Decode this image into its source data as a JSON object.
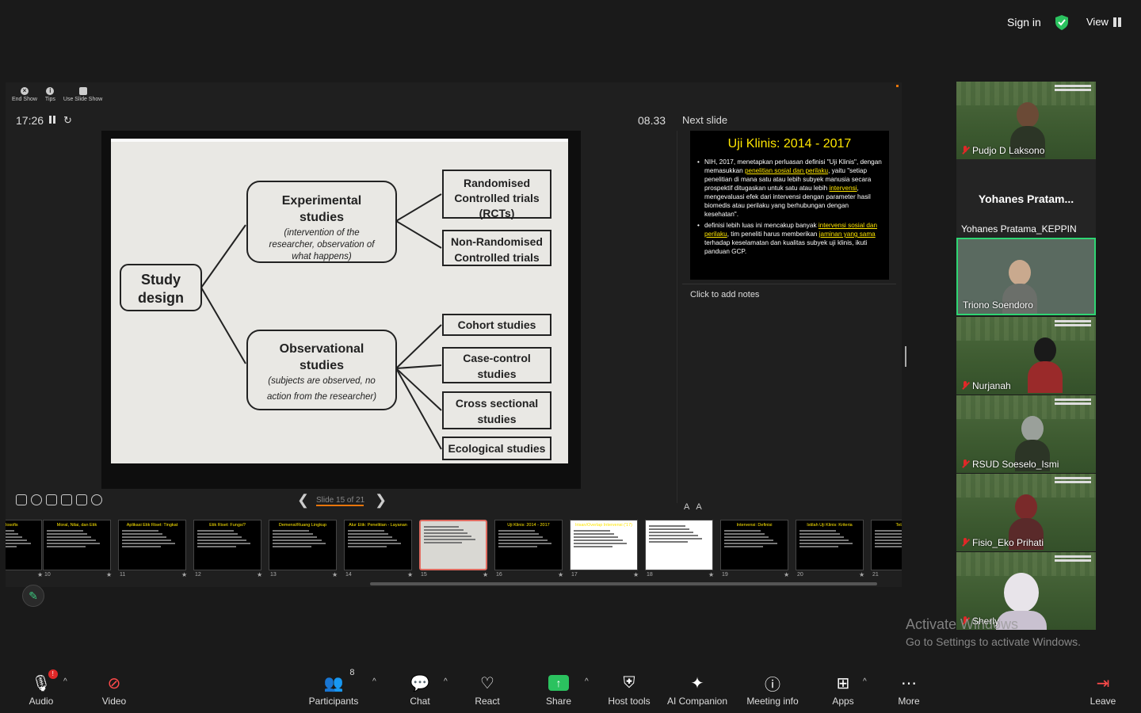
{
  "topbar": {
    "signin": "Sign in",
    "view": "View"
  },
  "presenter": {
    "tools": [
      "End Show",
      "Tips",
      "Use Slide Show"
    ],
    "timer": "17:26",
    "clock": "08.33",
    "next_label": "Next slide",
    "notes_placeholder": "Click to add notes",
    "slide_counter": "Slide 15 of 21",
    "font_bigger": "A",
    "font_smaller": "A"
  },
  "main_slide": {
    "root": [
      "Study",
      "design"
    ],
    "experimental": [
      "Experimental",
      "studies"
    ],
    "experimental_note": [
      "(intervention of the",
      "researcher, observation of",
      "what happens)"
    ],
    "observational": [
      "Observational",
      "studies"
    ],
    "observational_note": [
      "(subjects are observed, no",
      "action from the researcher)"
    ],
    "exp_children": [
      [
        "Randomised",
        "Controlled trials",
        "(RCTs)"
      ],
      [
        "Non-Randomised",
        "Controlled trials"
      ]
    ],
    "obs_children": [
      [
        "Cohort studies"
      ],
      [
        "Case-control",
        "studies"
      ],
      [
        "Cross sectional",
        "studies"
      ],
      [
        "Ecological studies"
      ]
    ]
  },
  "next_slide": {
    "title": "Uji Klinis: 2014 - 2017",
    "b1_pre": "NIH, 2017, menetapkan perluasan definisi \"Uji Klinis\", dengan memasukkan ",
    "b1_h1": "penelitian sosial dan perilaku",
    "b1_mid": ", yaitu \"setiap penelitian di mana satu atau lebih subyek manusia secara prospektif ditugaskan untuk satu atau lebih ",
    "b1_h2": "intervensi",
    "b1_post": ", mengevaluasi efek dari intervensi dengan parameter hasil biomedis atau perilaku yang berhubungan dengan kesehatan\".",
    "b2_pre": "definisi lebih luas ini mencakup banyak ",
    "b2_h1": "intervensi sosial dan perilaku",
    "b2_mid": ", tim peneliti harus memberikan ",
    "b2_h2": "jaminan yang sama",
    "b2_post": " terhadap keselamatan dan kualitas subyek uji klinis, ikuti panduan GCP."
  },
  "thumbnails": [
    {
      "num": "",
      "title": "& Filosofis"
    },
    {
      "num": "10",
      "title": "Moral, Nilai, dan Etik"
    },
    {
      "num": "11",
      "title": "Aplikasi Etik Riset: Tingkat"
    },
    {
      "num": "12",
      "title": "Etik Riset: Fungsi?"
    },
    {
      "num": "13",
      "title": "Demensi/Ruang Lingkup"
    },
    {
      "num": "14",
      "title": "Alur Etik: Penelitian - Layanan"
    },
    {
      "num": "15",
      "title": ""
    },
    {
      "num": "16",
      "title": "Uji Klinis: 2014 - 2017"
    },
    {
      "num": "17",
      "title": "Irisan/Overlap Intervensi ('17)"
    },
    {
      "num": "18",
      "title": ""
    },
    {
      "num": "19",
      "title": "Intervensi: Definisi"
    },
    {
      "num": "20",
      "title": "Istilah Uji Klinis: Kriteria"
    },
    {
      "num": "21",
      "title": "Telaah Et"
    }
  ],
  "participants": [
    {
      "name": "Pudjo D Laksono",
      "muted": true
    },
    {
      "name": "Yohanes Pratama_KEPPIN",
      "display": "Yohanes  Pratam...",
      "muted": false
    },
    {
      "name": "Triono Soendoro",
      "muted": false
    },
    {
      "name": "Nurjanah",
      "muted": true
    },
    {
      "name": "RSUD Soeselo_Ismi",
      "muted": true
    },
    {
      "name": "Fisio_Eko Prihati",
      "muted": true
    },
    {
      "name": "Sherly",
      "muted": true
    }
  ],
  "watermark": {
    "title": "Activate Windows",
    "sub": "Go to Settings to activate Windows."
  },
  "toolbar": {
    "audio": "Audio",
    "video": "Video",
    "participants": "Participants",
    "participants_count": "8",
    "chat": "Chat",
    "react": "React",
    "share": "Share",
    "host_tools": "Host tools",
    "ai": "AI Companion",
    "meeting_info": "Meeting info",
    "apps": "Apps",
    "more": "More",
    "leave": "Leave"
  },
  "colors": {
    "accent_green": "#2bc25f",
    "mute_red": "#e02828",
    "slide_title_yellow": "#ffe600",
    "active_speaker": "#2fd573"
  }
}
